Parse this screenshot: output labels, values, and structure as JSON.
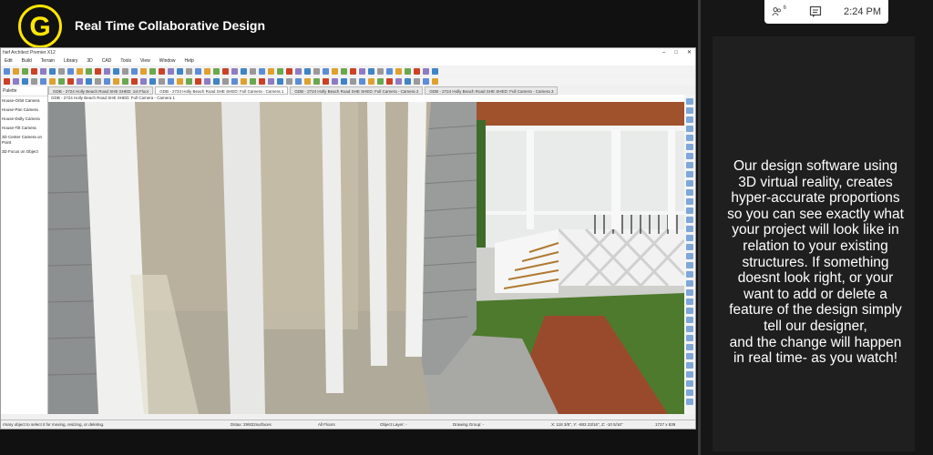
{
  "meeting": {
    "title": "Real Time Collaborative Design",
    "logo_letter": "G",
    "logo_color": "#ffe600",
    "time": "2:24 PM",
    "participants_count": "6",
    "icons": [
      "participants-icon",
      "chat-icon"
    ]
  },
  "caption": {
    "text": "Our design software using\n3D virtual reality, creates\nhyper-accurate proportions\nso you can see exactly what\nyour project will look like in\nrelation to your existing\nstructures. If something\ndoesnt look right, or your\nwant to add or delete a\nfeature of the design simply\ntell our designer,\nand the change will happen\nin real time- as you watch!"
  },
  "app": {
    "title": "hief Architect Premier X12",
    "window_controls": [
      "–",
      "□",
      "✕"
    ],
    "menu": [
      "Edit",
      "Build",
      "Terrain",
      "Library",
      "3D",
      "CAD",
      "Tools",
      "View",
      "Window",
      "Help"
    ],
    "tabs": [
      "GDB - 2724 Holly Beach Road SHE SHED: 1st Floor",
      "GDB - 2724 Holly Beach Road SHE SHED: Full Camera - Camera 1",
      "GDB - 2724 Holly Beach Road SHE SHED: Full Camera - Camera 2",
      "GDB - 2724 Holly Beach Road SHE SHED: Full Camera - Camera 3"
    ],
    "active_tab": 1,
    "view_header": "GDB - 2724 Holly Beach Road SHE SHED: Full Camera - Camera 1",
    "palette": {
      "title": "Palette",
      "items": [
        "House-Orbit Camera",
        "House-Pan Camera",
        "House-Dolly Camera",
        "House-Tilt Camera",
        "3D Center Camera on Point",
        "3D Focus on Object"
      ]
    },
    "status": {
      "hint": "rmary object to select it for moving, resizing, or deleting.",
      "layer_set": "Dstax: 29/822surfaces",
      "floors": "All Floors",
      "object_layer": "Object Layer: -",
      "drawing_group": "Drawing Group: -",
      "coords": "X: 118 3/8\", Y: -883 23/16\", Z: -10 5/16\"",
      "size": "1727 x 839"
    }
  }
}
